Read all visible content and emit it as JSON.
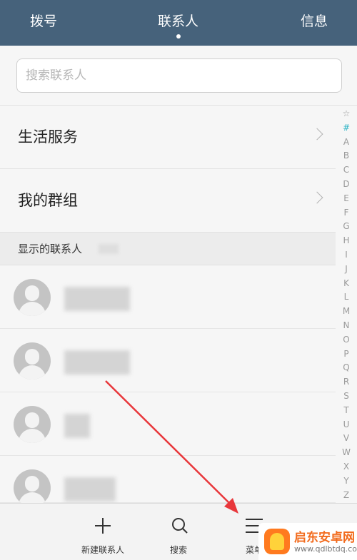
{
  "tabs": {
    "dial": "拨号",
    "contacts": "联系人",
    "messages": "信息"
  },
  "search": {
    "placeholder": "搜索联系人",
    "value": ""
  },
  "entries": [
    {
      "label": "生活服务"
    },
    {
      "label": "我的群组"
    }
  ],
  "section": {
    "label": "显示的联系人"
  },
  "index_letters": [
    "☆",
    "#",
    "A",
    "B",
    "C",
    "D",
    "E",
    "F",
    "G",
    "H",
    "I",
    "J",
    "K",
    "L",
    "M",
    "N",
    "O",
    "P",
    "Q",
    "R",
    "S",
    "T",
    "U",
    "V",
    "W",
    "X",
    "Y",
    "Z"
  ],
  "bottom_actions": {
    "new_contact": "新建联系人",
    "search": "搜索",
    "menu": "菜单"
  },
  "watermark": {
    "title": "启东安卓网",
    "url": "www.qdlbtdq.com"
  },
  "colors": {
    "tabbar": "#46627b",
    "index_active": "#2bb3c4",
    "annotation_arrow": "#e8373b"
  }
}
